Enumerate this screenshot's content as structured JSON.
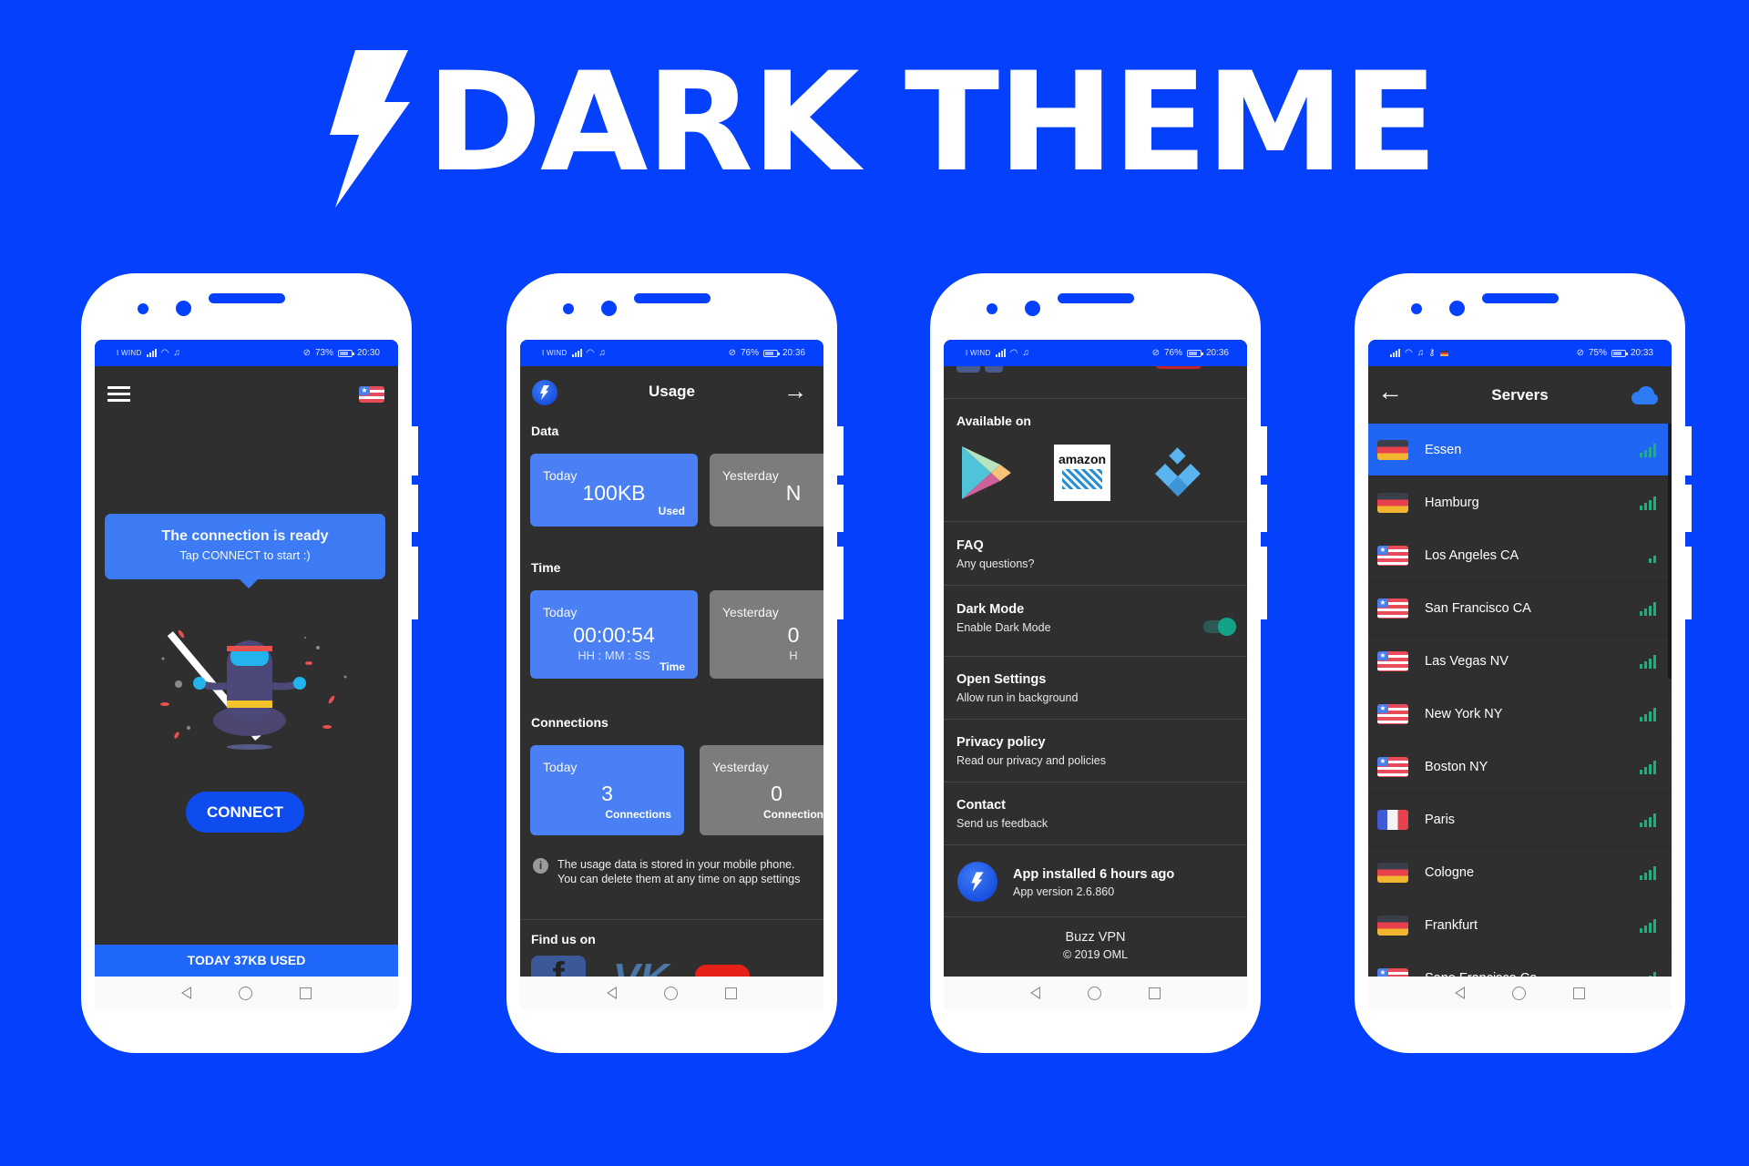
{
  "banner": {
    "title": "DARK THEME",
    "icon": "lightning-bolt-icon"
  },
  "colors": {
    "background": "#0540fd",
    "accent": "#2166f3",
    "card_blue": "#4a80f4",
    "card_gray": "#7c7c7c",
    "screen_bg": "#2f2f2f",
    "signal_green": "#1fae7e",
    "toggle_on": "#13a389"
  },
  "phones": {
    "home": {
      "status": {
        "carrier": "I WIND",
        "battery": "73%",
        "battery_level": 0.73,
        "time": "20:30"
      },
      "menu_icon": "hamburger-icon",
      "country_flag": "us-flag-icon",
      "bubble": {
        "line1": "The connection is ready",
        "line2": "Tap CONNECT to start :)"
      },
      "illustration": "meditating-ninja",
      "connect_label": "CONNECT",
      "usage_footer": "TODAY 37KB USED"
    },
    "usage": {
      "status": {
        "carrier": "I WIND",
        "battery": "76%",
        "battery_level": 0.76,
        "time": "20:36"
      },
      "title": "Usage",
      "sections": {
        "data": {
          "label": "Data",
          "today": {
            "day": "Today",
            "value": "100KB",
            "unit": "Used"
          },
          "yesterday": {
            "day": "Yesterday",
            "value": "N"
          }
        },
        "time": {
          "label": "Time",
          "today": {
            "day": "Today",
            "value": "00:00:54",
            "format": "HH : MM : SS",
            "unit": "Time"
          },
          "yesterday": {
            "day": "Yesterday",
            "value": "0",
            "format": "H"
          }
        },
        "connections": {
          "label": "Connections",
          "today": {
            "day": "Today",
            "value": "3",
            "unit": "Connections"
          },
          "yesterday": {
            "day": "Yesterday",
            "value": "0",
            "unit": "Connections"
          }
        }
      },
      "info_text": "The usage data is stored in your mobile phone. You can delete them at any time on app settings",
      "find_us_label": "Find us on",
      "social": [
        "facebook",
        "vk",
        "youtube"
      ]
    },
    "about": {
      "status": {
        "carrier": "I WIND",
        "battery": "76%",
        "battery_level": 0.76,
        "time": "20:36"
      },
      "available_label": "Available on",
      "stores": [
        "Google Play",
        "amazon",
        "Other store"
      ],
      "amazon_label": "amazon",
      "settings": [
        {
          "title": "FAQ",
          "subtitle": "Any questions?"
        },
        {
          "title": "Dark Mode",
          "subtitle": "Enable Dark Mode",
          "toggle": true
        },
        {
          "title": "Open Settings",
          "subtitle": "Allow run in background"
        },
        {
          "title": "Privacy policy",
          "subtitle": "Read our privacy and policies"
        },
        {
          "title": "Contact",
          "subtitle": "Send us feedback"
        }
      ],
      "installed": {
        "title": "App installed 6 hours ago",
        "version": "App version 2.6.860"
      },
      "footer": {
        "app_name": "Buzz VPN",
        "copyright": "© 2019 OML"
      }
    },
    "servers": {
      "status": {
        "battery": "75%",
        "battery_level": 0.75,
        "time": "20:33"
      },
      "title": "Servers",
      "list": [
        {
          "name": "Essen",
          "country": "de",
          "signal": 4,
          "selected": true
        },
        {
          "name": "Hamburg",
          "country": "de",
          "signal": 4
        },
        {
          "name": "Los Angeles CA",
          "country": "us",
          "signal": 2
        },
        {
          "name": "San Francisco CA",
          "country": "us",
          "signal": 4
        },
        {
          "name": "Las Vegas NV",
          "country": "us",
          "signal": 4
        },
        {
          "name": "New York NY",
          "country": "us",
          "signal": 4
        },
        {
          "name": "Boston NY",
          "country": "us",
          "signal": 4
        },
        {
          "name": "Paris",
          "country": "fr",
          "signal": 4
        },
        {
          "name": "Cologne",
          "country": "de",
          "signal": 4
        },
        {
          "name": "Frankfurt",
          "country": "de",
          "signal": 4
        },
        {
          "name": "Sane Francisco Ca",
          "country": "us",
          "signal": 4
        }
      ]
    }
  }
}
